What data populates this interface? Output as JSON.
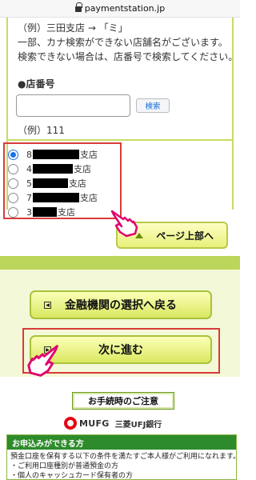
{
  "browser": {
    "url": "paymentstation.jp"
  },
  "search_panel": {
    "example_kana_line": "（例）三田支店 → 「ミ」",
    "note_line1": "一部、カナ検索ができない店舗名がございます。",
    "note_line2": "検索できない場合は、店番号で検索してください。",
    "store_number_label": "●店番号",
    "store_number_value": "",
    "search_button": "検索",
    "example_number": "（例）111"
  },
  "branch_list": {
    "items": [
      {
        "prefix": "8",
        "suffix": "支店",
        "selected": true
      },
      {
        "prefix": "4",
        "suffix": "支店",
        "selected": false
      },
      {
        "prefix": "5",
        "suffix": "支店",
        "selected": false
      },
      {
        "prefix": "7",
        "suffix": "支店",
        "selected": false
      },
      {
        "prefix": "3",
        "suffix": "支店",
        "selected": false
      }
    ]
  },
  "buttons": {
    "page_top": "ページ上部へ",
    "back_to_bank": "金融機関の選択へ戻る",
    "next": "次に進む",
    "notice": "お手続時のご注意"
  },
  "footer": {
    "brand": "MUFG",
    "bank_name": "三菱UFJ銀行",
    "conditions_title": "お申込みができる方",
    "conditions_line1": "預金口座を保有する以下の条件を満たすご本人様がご利用になれます。",
    "conditions_line2": "・ご利用口座種別が普通預金の方",
    "conditions_line3": "・個人のキャッシュカード保有者の方"
  },
  "colors": {
    "accent_green": "#bcd65b",
    "highlight_red": "#d93b3b",
    "radio_blue": "#1a73e8"
  }
}
